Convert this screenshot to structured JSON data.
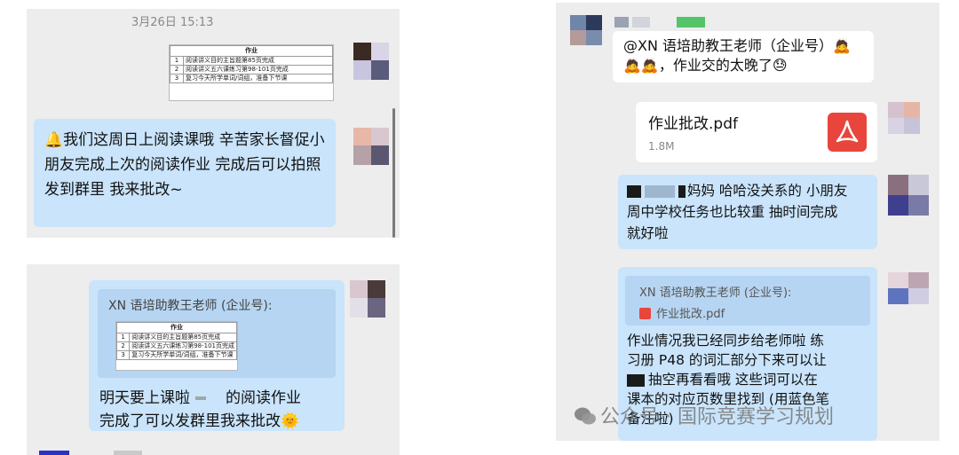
{
  "left_top": {
    "timestamp": "3月26日 15:13",
    "homework": {
      "header": "作业",
      "rows": [
        {
          "n": "1",
          "text": "阅读讲义目的主旨题第85页完成"
        },
        {
          "n": "2",
          "text": "阅读讲义五六课练习第98-101页完成"
        },
        {
          "n": "3",
          "text": "复习今天所学单词/词组，准备下节课"
        }
      ]
    },
    "message": "🔔我们这周日上阅读课哦 辛苦家长督促小朋友完成上次的阅读作业 完成后可以拍照发到群里 我来批改~"
  },
  "left_bottom": {
    "quote_sender": "XN 语培助教王老师 (企业号):",
    "homework": {
      "header": "作业",
      "rows": [
        {
          "n": "1",
          "text": "阅读讲义目的主旨题第85页完成"
        },
        {
          "n": "2",
          "text": "阅读讲义五六课练习第98-101页完成"
        },
        {
          "n": "3",
          "text": "复习今天所学单词/词组，准备下节课"
        }
      ]
    },
    "message_line1_a": "明天要上课啦",
    "message_line1_b": "的阅读作业",
    "message_line2": "完成了可以发群里我来批改🌞"
  },
  "right": {
    "mention_line1": "@XN 语培助教王老师（企业号）🙇",
    "mention_line2": "🙇🙇，作业交的太晚了😓",
    "file": {
      "name": "作业批改.pdf",
      "size": "1.8M"
    },
    "reply1_line1": "妈妈 哈哈没关系的 小朋友",
    "reply1_line2": "周中学校任务也比较重 抽时间完成",
    "reply1_line3": "就好啦",
    "quote_sender": "XN 语培助教王老师 (企业号):",
    "quote_file": "作业批改.pdf",
    "reply2_line1": "作业情况我已经同步给老师啦 练",
    "reply2_line2": "习册 P48 的词汇部分下来可以让",
    "reply2_line3": "抽空再看看哦 这些词可以在",
    "reply2_line4": "课本的对应页数里找到 (用蓝色笔",
    "reply2_line5": "备注啦)"
  },
  "watermark": "公众号 · 国际竞赛学习规划",
  "colors": {
    "bubble_blue": "#c9e4fb",
    "panel_gray": "#ededed",
    "pdf_red": "#e8453c"
  }
}
